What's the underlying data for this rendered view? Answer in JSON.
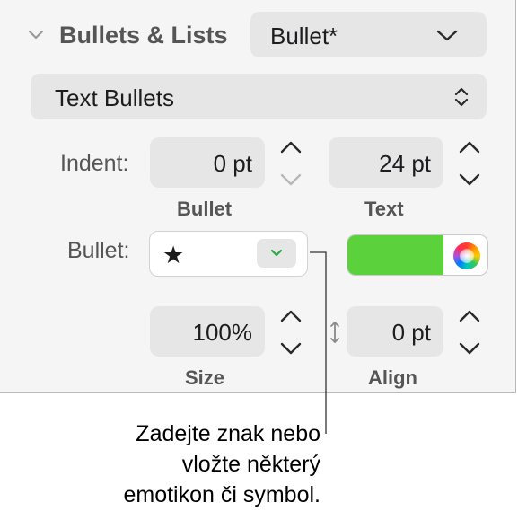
{
  "section": {
    "title": "Bullets & Lists",
    "preset_value": "Bullet*"
  },
  "bullet_type": {
    "value": "Text Bullets"
  },
  "indent": {
    "label": "Indent:",
    "bullet_value": "0 pt",
    "bullet_caption": "Bullet",
    "text_value": "24 pt",
    "text_caption": "Text"
  },
  "bullet": {
    "label": "Bullet:",
    "symbol": "★",
    "color": "#5bd13c"
  },
  "size_align": {
    "size_value": "100%",
    "size_caption": "Size",
    "align_value": "0 pt",
    "align_caption": "Align"
  },
  "annotation": {
    "line1": "Zadejte znak nebo",
    "line2": "vložte některý",
    "line3": "emotikon či symbol."
  },
  "icons": {
    "collapse": "chevron-down-icon",
    "dropdown": "chevron-down-icon",
    "popup": "up-down-chevron-icon",
    "color_wheel": "color-wheel-icon",
    "spacing": "vertical-resize-icon"
  }
}
